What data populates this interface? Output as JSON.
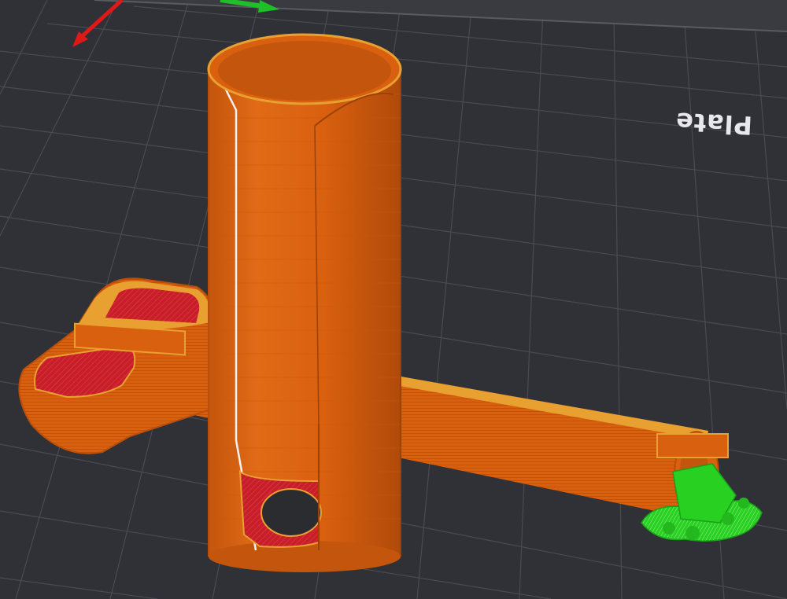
{
  "viewport": {
    "plate_label": "Plate",
    "colors": {
      "background": "#303136",
      "grid": "#4a4b52",
      "outer_wall": "#d9600f",
      "inner_wall": "#e8a030",
      "top_solid_infill": "#c81e2a",
      "support": "#28d022",
      "axis_x": "#e01818",
      "axis_y": "#1fbf2a"
    },
    "objects": [
      "tube",
      "key-handle",
      "key-shaft",
      "support-material"
    ]
  }
}
